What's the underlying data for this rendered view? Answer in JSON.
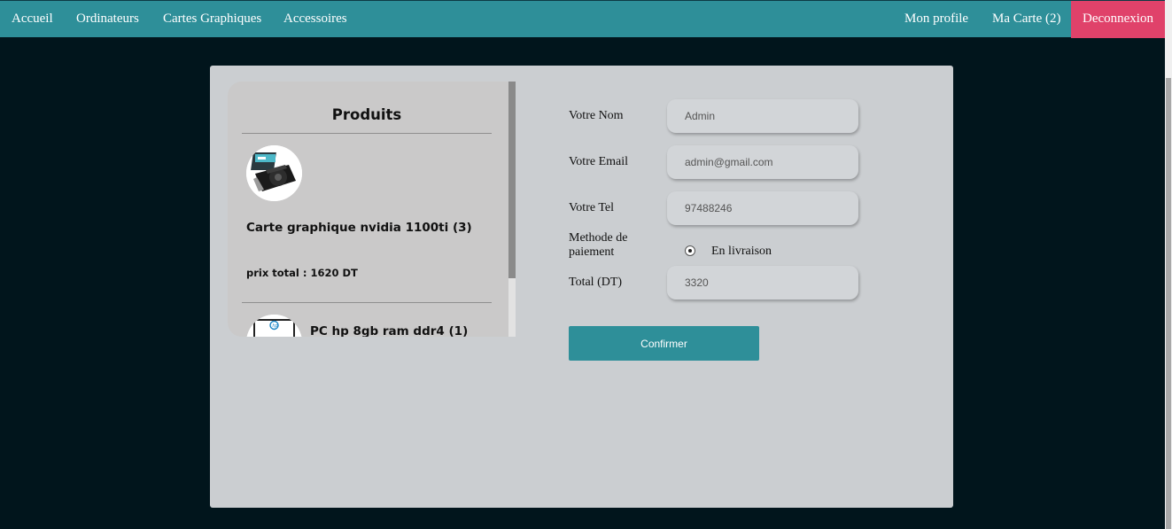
{
  "nav": {
    "left": [
      "Accueil",
      "Ordinateurs",
      "Cartes Graphiques",
      "Accessoires"
    ],
    "profile": "Mon profile",
    "cart": "Ma Carte (2)",
    "logout": "Deconnexion"
  },
  "colors": {
    "nav_bg": "#2e8f99",
    "logout_bg": "#e0426a",
    "page_bg": "#01151c",
    "card_bg": "#cbced1"
  },
  "products": {
    "title": "Produits",
    "items": [
      {
        "name": "Carte graphique nvidia 1100ti (3)",
        "total": "prix total : 1620 DT"
      },
      {
        "name": "PC hp 8gb ram ddr4 (1)"
      }
    ]
  },
  "form": {
    "name_label": "Votre Nom",
    "name_value": "Admin",
    "email_label": "Votre Email",
    "email_value": "admin@gmail.com",
    "tel_label": "Votre Tel",
    "tel_value": "97488246",
    "payment_label_1": "Methode de",
    "payment_label_2": "paiement",
    "payment_option": "En livraison",
    "total_label": "Total (DT)",
    "total_value": "3320",
    "confirm": "Confirmer"
  }
}
